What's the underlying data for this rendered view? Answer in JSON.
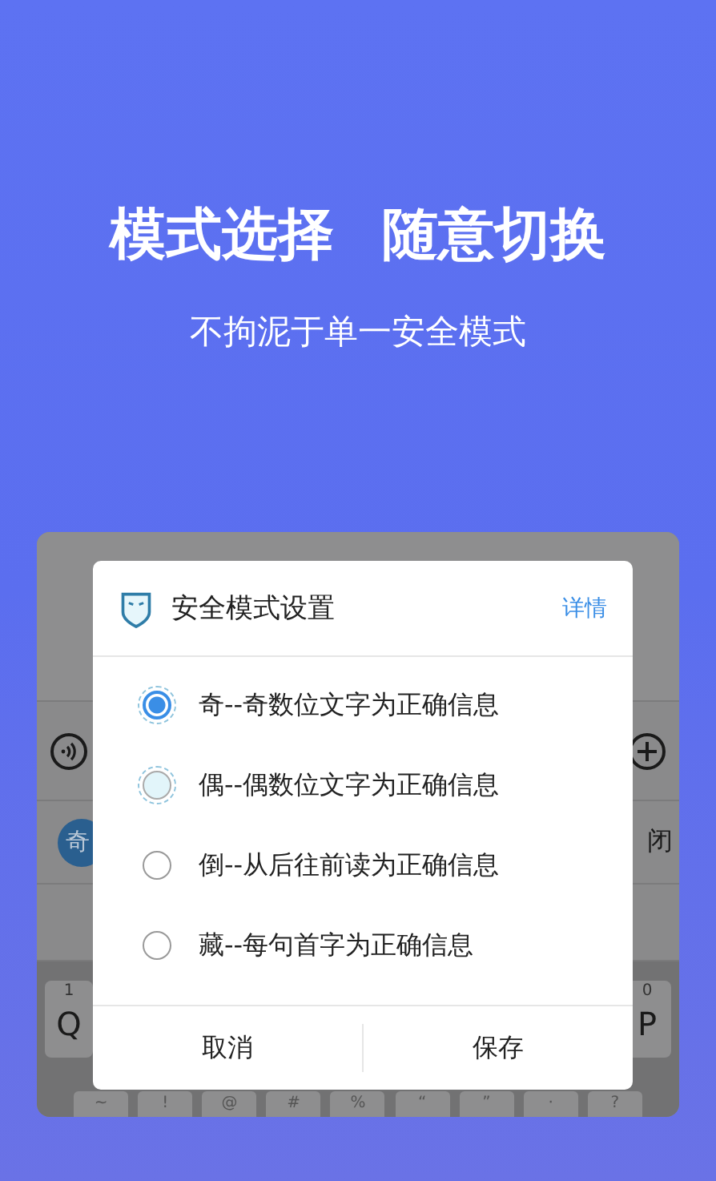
{
  "headline": [
    "模式选择",
    "随意切换"
  ],
  "subtitle": "不拘泥于单一安全模式",
  "background_app": {
    "chip": "奇",
    "side_text": "闭",
    "keys": [
      {
        "number": "1",
        "letter": "Q"
      },
      {
        "number": "0",
        "letter": "P"
      }
    ],
    "symbol_keys": [
      "~",
      "!",
      "@",
      "#",
      "%",
      "“",
      "”",
      "·",
      "?"
    ]
  },
  "dialog": {
    "title": "安全模式设置",
    "link": "详情",
    "options": [
      {
        "label": "奇--奇数位文字为正确信息",
        "selected": true,
        "highlighted": false
      },
      {
        "label": "偶--偶数位文字为正确信息",
        "selected": false,
        "highlighted": true
      },
      {
        "label": "倒--从后往前读为正确信息",
        "selected": false,
        "highlighted": false
      },
      {
        "label": "藏--每句首字为正确信息",
        "selected": false,
        "highlighted": false
      }
    ],
    "buttons": [
      "取消",
      "保存"
    ]
  }
}
